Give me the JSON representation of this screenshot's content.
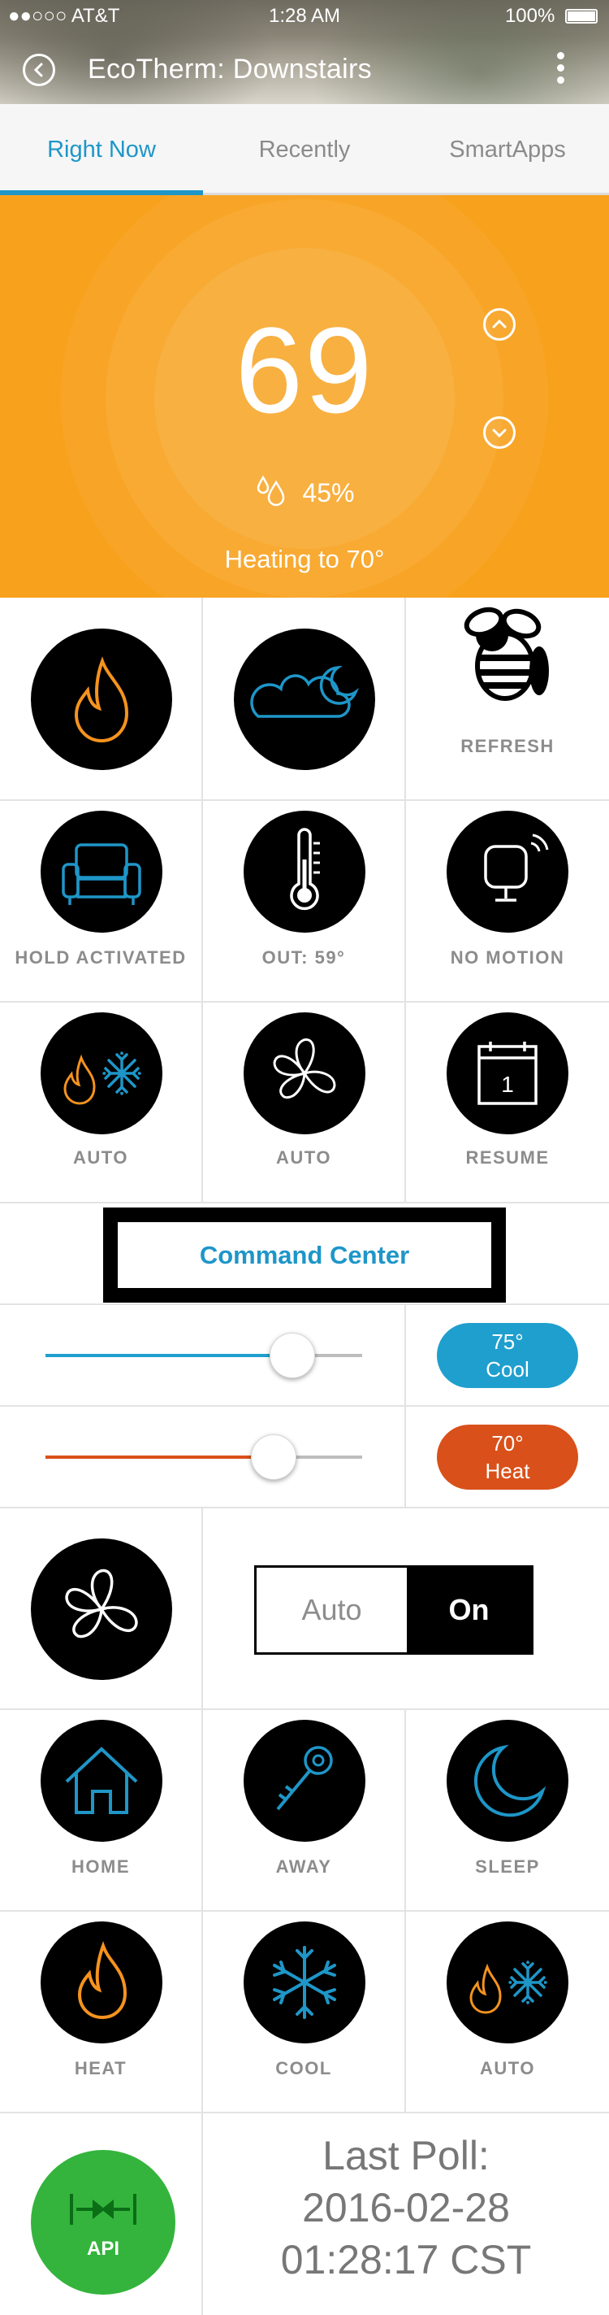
{
  "status_bar": {
    "carrier": "●●○○○ AT&T",
    "time": "1:28 AM",
    "battery": "100%"
  },
  "header": {
    "title": "EcoTherm: Downstairs"
  },
  "tabs": [
    {
      "label": "Right Now",
      "active": true
    },
    {
      "label": "Recently",
      "active": false
    },
    {
      "label": "SmartApps",
      "active": false
    }
  ],
  "thermostat": {
    "temperature": "69",
    "humidity": "45%",
    "status": "Heating to 70°",
    "accent_color": "#f8a11c"
  },
  "tiles_row1": {
    "refresh_label": "REFRESH"
  },
  "tiles_row2": {
    "hold_label": "HOLD ACTIVATED",
    "outside_label": "OUT: 59°",
    "motion_label": "NO MOTION"
  },
  "tiles_row3": {
    "mode_label": "AUTO",
    "fan_label": "AUTO",
    "resume_label": "RESUME",
    "calendar_number": "1"
  },
  "command_center": {
    "label": "Command Center"
  },
  "cool_setpoint": {
    "temp": "75°",
    "mode": "Cool",
    "slider_fraction": 0.78,
    "color": "#1f9fce"
  },
  "heat_setpoint": {
    "temp": "70°",
    "mode": "Heat",
    "slider_fraction": 0.72,
    "color": "#d9501a"
  },
  "fan_mode": {
    "off_label": "Auto",
    "on_label": "On"
  },
  "presets": {
    "home": "HOME",
    "away": "AWAY",
    "sleep": "SLEEP"
  },
  "modes": {
    "heat": "HEAT",
    "cool": "COOL",
    "auto": "AUTO"
  },
  "poll": {
    "api_label": "API",
    "line1": "Last Poll:",
    "line2": "2016-02-28",
    "line3": "01:28:17 CST"
  }
}
